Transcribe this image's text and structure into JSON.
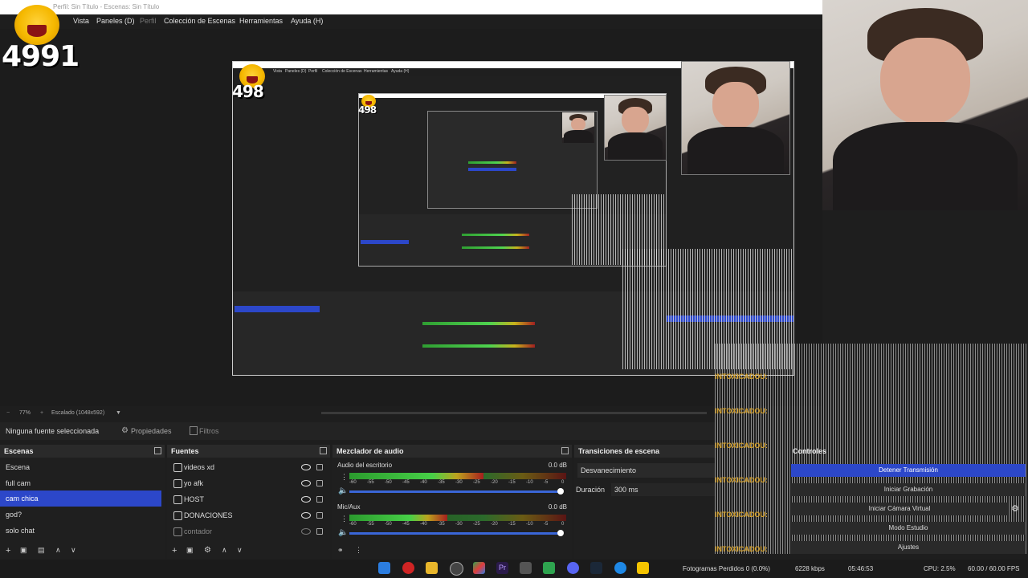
{
  "window": {
    "title_partial": "Perfil: Sin Título - Escenas: Sin Título"
  },
  "menu": {
    "items": [
      "Vista",
      "Paneles (D)",
      "Perfil",
      "Colección de Escenas",
      "Herramientas",
      "Ayuda (H)"
    ]
  },
  "overlay": {
    "counter": "4991",
    "nested_counter": "498",
    "inner_counter": "498"
  },
  "nested_menu": [
    "Vista",
    "Paneles (D)",
    "Perfil",
    "Colección de Escenas",
    "Herramientas",
    "Ayuda (H)"
  ],
  "preview_status": {
    "zoom": "77%",
    "scaling": "Escalado (1048x592)"
  },
  "source_toolbar": {
    "no_source": "Ninguna fuente seleccionada",
    "properties": "Propiedades",
    "filters": "Filtros"
  },
  "scenes": {
    "title": "Escenas",
    "items": [
      "Escena",
      "full cam",
      "cam chica",
      "god?",
      "solo chat"
    ],
    "selected_index": 2
  },
  "sources": {
    "title": "Fuentes",
    "items": [
      "videos xd",
      "yo afk",
      "HOST",
      "DONACIONES",
      "contador"
    ]
  },
  "mixer": {
    "title": "Mezclador de audio",
    "channels": [
      {
        "name": "Audio del escritorio",
        "db": "0.0 dB",
        "level": 0.62
      },
      {
        "name": "Mic/Aux",
        "db": "0.0 dB",
        "level": 0.45
      }
    ],
    "scale": [
      "-60",
      "-55",
      "-50",
      "-45",
      "-40",
      "-35",
      "-30",
      "-25",
      "-20",
      "-15",
      "-10",
      "-5",
      "0"
    ]
  },
  "transitions": {
    "title": "Transiciones de escena",
    "type": "Desvanecimiento",
    "duration_label": "Duración",
    "duration_value": "300 ms"
  },
  "controls": {
    "title": "Controles",
    "buttons": [
      "Detener Transmisión",
      "Iniciar Grabación",
      "Iniciar Cámara Virtual",
      "Modo Estudio",
      "Ajustes"
    ],
    "active_index": 0
  },
  "chat_overlay": {
    "word": "INTOXICADOU:"
  },
  "status_bar": {
    "frames": "Fotogramas Perdidos 0 (0.0%)",
    "kbps": "6228 kbps",
    "live_time": "05:46:53",
    "cpu": "CPU: 2.5%",
    "fps": "60.00 / 60.00 FPS"
  },
  "colors": {
    "selected": "#2c47c9",
    "bg": "#1e1e1e",
    "dock_header": "#2a2a2a",
    "accent_overlay": "#d6a12a"
  }
}
